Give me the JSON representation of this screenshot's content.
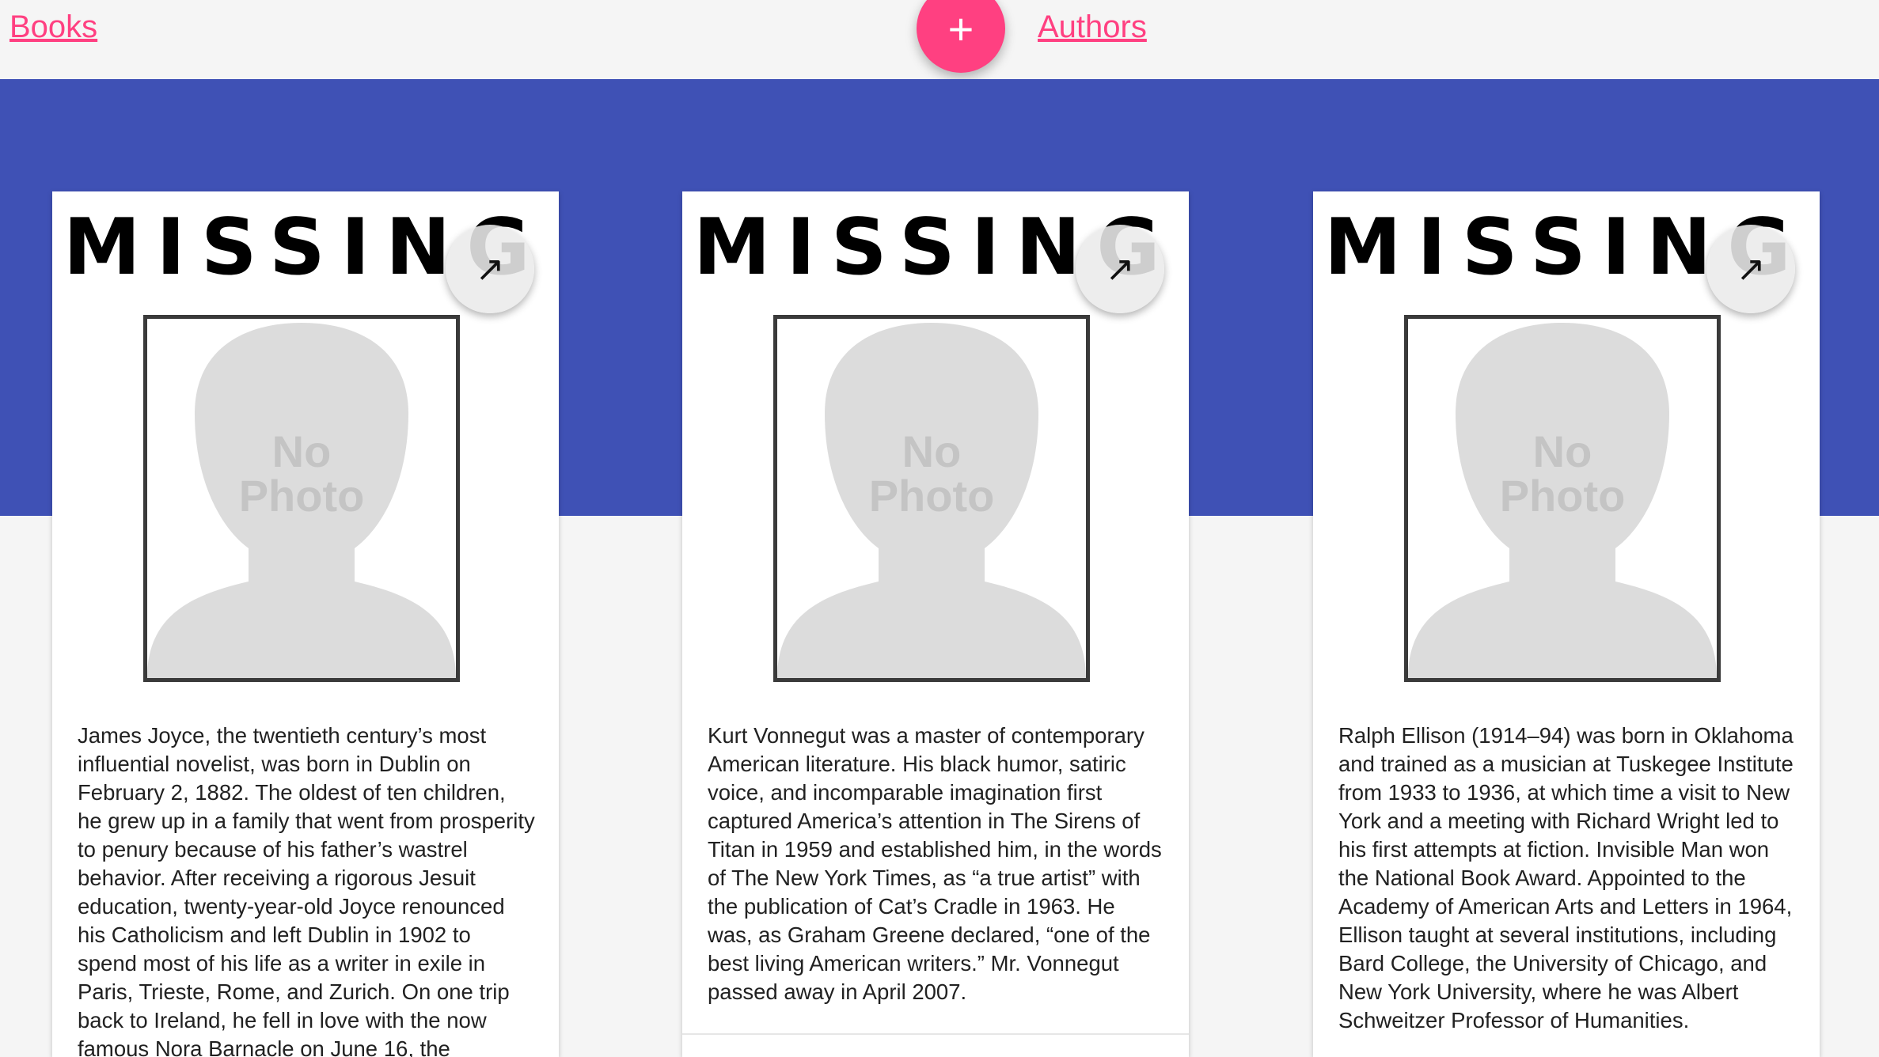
{
  "nav": {
    "books_label": "Books",
    "authors_label": "Authors",
    "add_glyph": "+"
  },
  "colors": {
    "accent": "#ff4081",
    "banner": "#3f51b5",
    "background": "#f5f5f5"
  },
  "cards": [
    {
      "missing_title": "MISSING",
      "photo_text_line1": "No",
      "photo_text_line2": "Photo",
      "expand_icon": "↗",
      "bio": "James Joyce, the twentieth century’s most influential novelist, was born in Dublin on February 2, 1882. The oldest of ten children, he grew up in a family that went from prosperity to penury because of his father’s wastrel behavior. After receiving a rigorous Jesuit education, twenty-year-old Joyce renounced his Catholicism and left Dublin in 1902 to spend most of his life as a writer in exile in Paris, Trieste, Rome, and Zurich. On one trip back to Ireland, he fell in love with the now famous Nora Barnacle on June 16, the"
    },
    {
      "missing_title": "MISSING",
      "photo_text_line1": "No",
      "photo_text_line2": "Photo",
      "expand_icon": "↗",
      "bio": "Kurt Vonnegut was a master of contemporary American literature. His black humor, satiric voice, and incomparable imagination first captured America’s attention in The Sirens of Titan in 1959 and established him, in the words of The New York Times, as “a true artist” with the publication of Cat’s Cradle in 1963. He was, as Graham Greene declared, “one of the best living American writers.” Mr. Vonnegut passed away in April 2007."
    },
    {
      "missing_title": "MISSING",
      "photo_text_line1": "No",
      "photo_text_line2": "Photo",
      "expand_icon": "↗",
      "bio": "Ralph Ellison (1914–94) was born in Oklahoma and trained as a musician at Tuskegee Institute from 1933 to 1936, at which time a visit to New York and a meeting with Richard Wright led to his first attempts at fiction. Invisible Man won the National Book Award. Appointed to the Academy of American Arts and Letters in 1964, Ellison taught at several institutions, including Bard College, the University of Chicago, and New York University, where he was Albert Schweitzer Professor of Humanities."
    }
  ]
}
